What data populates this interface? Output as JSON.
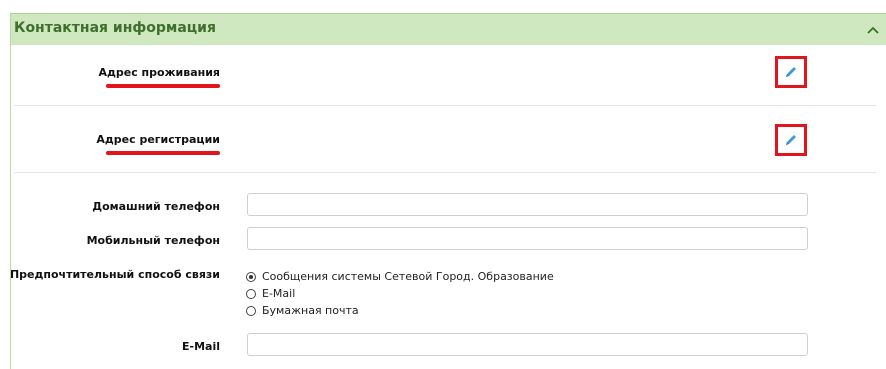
{
  "section": {
    "title": "Контактная информация"
  },
  "addresses": [
    {
      "label": "Адрес проживания"
    },
    {
      "label": "Адрес регистрации"
    }
  ],
  "fields": {
    "home_phone": {
      "label": "Домашний телефон",
      "value": ""
    },
    "mobile_phone": {
      "label": "Мобильный телефон",
      "value": ""
    },
    "email": {
      "label": "E-Mail",
      "value": ""
    }
  },
  "contact_method": {
    "label": "Предпочтительный способ связи",
    "selected_index": 0,
    "options": [
      {
        "label": "Сообщения системы Сетевой Город. Образование"
      },
      {
        "label": "E-Mail"
      },
      {
        "label": "Бумажная почта"
      }
    ]
  },
  "colors": {
    "header_bg": "#cfe8bf",
    "header_text": "#3f6f2d",
    "highlight_red": "#e3141b",
    "edit_icon": "#3a9bd6"
  }
}
